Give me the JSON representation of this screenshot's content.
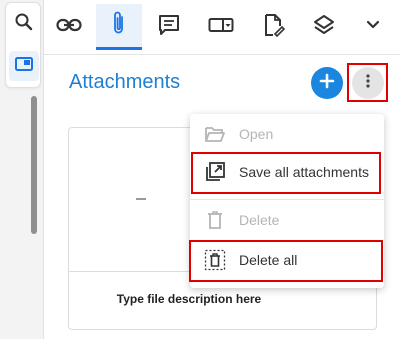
{
  "panel": {
    "title": "Attachments"
  },
  "toolbar": {
    "tools": [
      "link-icon",
      "paperclip-icon",
      "comment-icon",
      "form-field-icon",
      "sign-document-icon",
      "layers-icon",
      "chevron-down-icon"
    ],
    "active_tool": "paperclip-icon"
  },
  "left_rail": {
    "items": [
      "search-icon",
      "panel-icon"
    ]
  },
  "menu": {
    "open_label": "Open",
    "save_all_label": "Save all attachments",
    "delete_label": "Delete",
    "delete_all_label": "Delete all"
  },
  "attachment": {
    "description_placeholder": "Type file description here"
  },
  "colors": {
    "accent": "#1a86e0",
    "highlight": "#e00000"
  }
}
